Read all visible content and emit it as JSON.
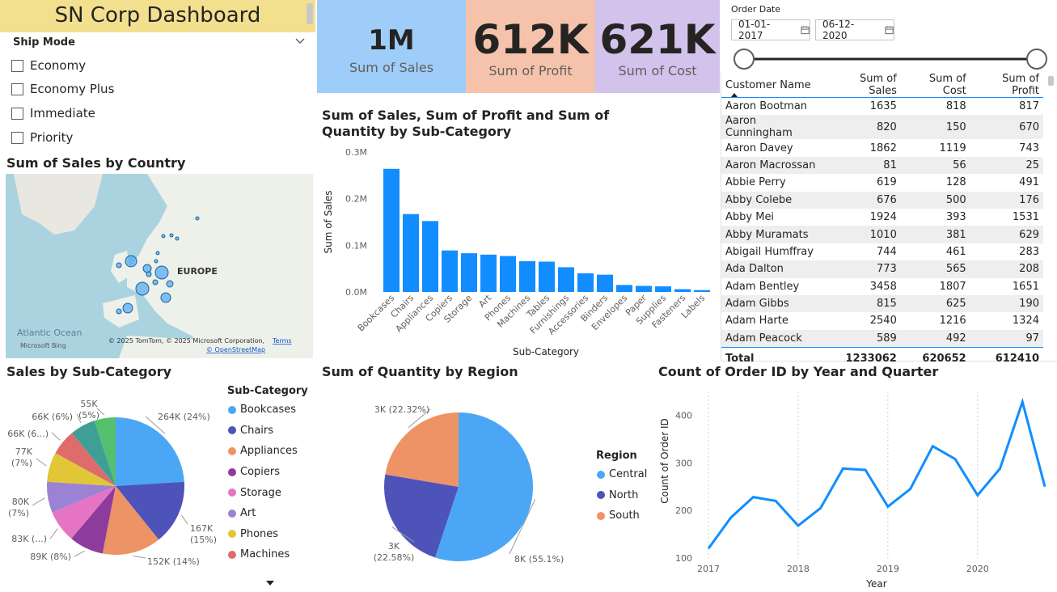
{
  "dashboard": {
    "title": "SN Corp Dashboard"
  },
  "ship_mode": {
    "title": "Ship Mode",
    "options": [
      "Economy",
      "Economy Plus",
      "Immediate",
      "Priority"
    ]
  },
  "kpis": [
    {
      "value": "1M",
      "label": "Sum of Sales",
      "color": "#9fcdf9"
    },
    {
      "value": "612K",
      "label": "Sum of Profit",
      "color": "#f5c3ac"
    },
    {
      "value": "621K",
      "label": "Sum of Cost",
      "color": "#d3c2ec"
    }
  ],
  "order_date": {
    "title": "Order Date",
    "start": "01-01-2017",
    "end": "06-12-2020"
  },
  "map": {
    "title": "Sum of Sales by Country",
    "region_label": "EUROPE",
    "ocean_label": "Atlantic Ocean",
    "attribution": "© 2025 TomTom, © 2025 Microsoft Corporation,",
    "terms": "Terms",
    "osm": "© OpenStreetMap",
    "brand": "Microsoft Bing"
  },
  "customer_table": {
    "columns": [
      "Customer Name",
      "Sum of Sales",
      "Sum of Cost",
      "Sum of Profit"
    ],
    "rows": [
      [
        "Aaron Bootman",
        "1635",
        "818",
        "817"
      ],
      [
        "Aaron Cunningham",
        "820",
        "150",
        "670"
      ],
      [
        "Aaron Davey",
        "1862",
        "1119",
        "743"
      ],
      [
        "Aaron Macrossan",
        "81",
        "56",
        "25"
      ],
      [
        "Abbie Perry",
        "619",
        "128",
        "491"
      ],
      [
        "Abby Colebe",
        "676",
        "500",
        "176"
      ],
      [
        "Abby Mei",
        "1924",
        "393",
        "1531"
      ],
      [
        "Abby Muramats",
        "1010",
        "381",
        "629"
      ],
      [
        "Abigail Humffray",
        "744",
        "461",
        "283"
      ],
      [
        "Ada Dalton",
        "773",
        "565",
        "208"
      ],
      [
        "Adam Bentley",
        "3458",
        "1807",
        "1651"
      ],
      [
        "Adam Gibbs",
        "815",
        "625",
        "190"
      ],
      [
        "Adam Harte",
        "2540",
        "1216",
        "1324"
      ],
      [
        "Adam Peacock",
        "589",
        "492",
        "97"
      ]
    ],
    "total": [
      "Total",
      "1233062",
      "620652",
      "612410"
    ]
  },
  "chart_data": [
    {
      "type": "bar",
      "title": "Sum of Sales, Sum of Profit and Sum of Quantity by Sub-Category",
      "xlabel": "Sub-Category",
      "ylabel": "Sum of Sales",
      "ylim": [
        0,
        300000
      ],
      "yticks": [
        "0.0M",
        "0.1M",
        "0.2M",
        "0.3M"
      ],
      "categories": [
        "Bookcases",
        "Chairs",
        "Appliances",
        "Copiers",
        "Storage",
        "Art",
        "Phones",
        "Machines",
        "Tables",
        "Furnishings",
        "Accessories",
        "Binders",
        "Envelopes",
        "Paper",
        "Supplies",
        "Fasteners",
        "Labels"
      ],
      "values": [
        264000,
        167000,
        152000,
        89000,
        83000,
        80000,
        77000,
        66000,
        65000,
        53000,
        40000,
        37000,
        15000,
        13000,
        12000,
        6000,
        4000
      ],
      "color": "#118dff"
    },
    {
      "type": "pie",
      "title": "Sales by Sub-Category",
      "legend_title": "Sub-Category",
      "legend": [
        "Bookcases",
        "Chairs",
        "Appliances",
        "Copiers",
        "Storage",
        "Art",
        "Phones",
        "Machines"
      ],
      "slices": [
        {
          "name": "Bookcases",
          "value": 264,
          "label": "264K (24%)",
          "color": "#4ba7f5"
        },
        {
          "name": "Chairs",
          "value": 167,
          "label": "167K (15%)",
          "color": "#4d53b8"
        },
        {
          "name": "Appliances",
          "value": 152,
          "label": "152K (14%)",
          "color": "#ee9365"
        },
        {
          "name": "Copiers",
          "value": 89,
          "label": "89K (8%)",
          "color": "#8e3b9e"
        },
        {
          "name": "Storage",
          "value": 83,
          "label": "83K (...)",
          "color": "#e575c4"
        },
        {
          "name": "Art",
          "value": 80,
          "label": "80K (7%)",
          "color": "#9c82d4"
        },
        {
          "name": "Phones",
          "value": 77,
          "label": "77K (7%)",
          "color": "#e1c637"
        },
        {
          "name": "Machines",
          "value": 66,
          "label": "66K (6...)",
          "color": "#df6b6b"
        },
        {
          "name": "Tables",
          "value": 66,
          "label": "66K (6%)",
          "color": "#3e9f95"
        },
        {
          "name": "Furnishings",
          "value": 55,
          "label": "55K (5%)",
          "color": "#55c06e"
        }
      ]
    },
    {
      "type": "pie",
      "title": "Sum of Quantity by Region",
      "legend_title": "Region",
      "slices": [
        {
          "name": "Central",
          "value": 55.1,
          "label": "8K (55.1%)",
          "color": "#4ba7f5"
        },
        {
          "name": "North",
          "value": 22.58,
          "label": "3K (22.58%)",
          "color": "#4d53b8"
        },
        {
          "name": "South",
          "value": 22.32,
          "label": "3K (22.32%)",
          "color": "#ee9365"
        }
      ]
    },
    {
      "type": "line",
      "title": "Count of Order ID by Year and Quarter",
      "xlabel": "Year",
      "ylabel": "Count of Order ID",
      "xticks": [
        "2017",
        "2018",
        "2019",
        "2020"
      ],
      "ylim": [
        100,
        450
      ],
      "yticks": [
        "100",
        "200",
        "300",
        "400"
      ],
      "x": [
        "2017 Q1",
        "2017 Q2",
        "2017 Q3",
        "2017 Q4",
        "2018 Q1",
        "2018 Q2",
        "2018 Q3",
        "2018 Q4",
        "2019 Q1",
        "2019 Q2",
        "2019 Q3",
        "2019 Q4",
        "2020 Q1",
        "2020 Q2",
        "2020 Q3",
        "2020 Q4"
      ],
      "values": [
        120,
        185,
        228,
        220,
        168,
        205,
        288,
        285,
        208,
        245,
        335,
        308,
        232,
        288,
        428,
        250
      ],
      "color": "#118dff"
    }
  ]
}
